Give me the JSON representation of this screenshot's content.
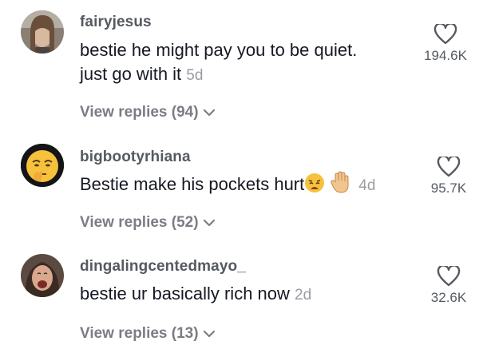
{
  "comments": [
    {
      "username": "fairyjesus",
      "text_line1": "bestie he might pay you to be quiet.",
      "text_line2": "just go with it",
      "age": "5d",
      "likes": "194.6K",
      "replies_label": "View replies (94)"
    },
    {
      "username": "bigbootyrhiana",
      "text_line1": "Bestie make his pockets hurt",
      "emojis": [
        "weary-face",
        "raised-hand"
      ],
      "age": "4d",
      "likes": "95.7K",
      "replies_label": "View replies (52)"
    },
    {
      "username": "dingalingcentedmayo_",
      "text_line1": "bestie ur basically rich now",
      "age": "2d",
      "likes": "32.6K",
      "replies_label": "View replies (13)"
    }
  ],
  "icons": {
    "like": "heart-outline-icon",
    "expand": "chevron-down-icon"
  },
  "colors": {
    "username": "#555a61",
    "text": "#161823",
    "muted": "#9a9ca3"
  }
}
